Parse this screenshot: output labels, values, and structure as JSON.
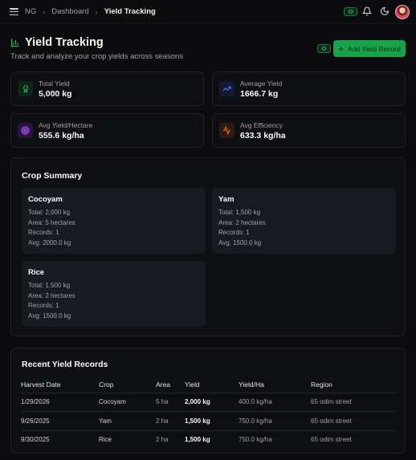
{
  "breadcrumb": {
    "items": [
      "NG",
      "Dashboard"
    ],
    "current": "Yield Tracking"
  },
  "header": {
    "title": "Yield Tracking",
    "subtitle": "Track and analyze your crop yields across seasons",
    "add_button": "Add Yield Record"
  },
  "stats": [
    {
      "label": "Total Yield",
      "value": "5,000 kg",
      "icon": "award-icon",
      "color": "#22c55e"
    },
    {
      "label": "Average Yield",
      "value": "1666.7 kg",
      "icon": "trending-up-icon",
      "color": "#3b82f6"
    },
    {
      "label": "Avg Yield/Hectare",
      "value": "555.6 kg/ha",
      "icon": "target-icon",
      "color": "#a855f7"
    },
    {
      "label": "Avg Efficiency",
      "value": "633.3 kg/ha",
      "icon": "activity-icon",
      "color": "#f97316"
    }
  ],
  "crop_summary": {
    "title": "Crop Summary",
    "crops": [
      {
        "name": "Cocoyam",
        "total": "Total: 2,000 kg",
        "area": "Area: 5 hectares",
        "records": "Records: 1",
        "avg": "Avg: 2000.0 kg"
      },
      {
        "name": "Yam",
        "total": "Total: 1,500 kg",
        "area": "Area: 2 hectares",
        "records": "Records: 1",
        "avg": "Avg: 1500.0 kg"
      },
      {
        "name": "Rice",
        "total": "Total: 1,500 kg",
        "area": "Area: 2 hectares",
        "records": "Records: 1",
        "avg": "Avg: 1500.0 kg"
      }
    ]
  },
  "records": {
    "title": "Recent Yield Records",
    "columns": [
      "Harvest Date",
      "Crop",
      "Area",
      "Yield",
      "Yield/Ha",
      "Region"
    ],
    "rows": [
      [
        "1/29/2026",
        "Cocoyam",
        "5 ha",
        "2,000 kg",
        "400.0 kg/ha",
        "65 odim street"
      ],
      [
        "9/26/2025",
        "Yam",
        "2 ha",
        "1,500 kg",
        "750.0 kg/ha",
        "65 odim street"
      ],
      [
        "9/30/2025",
        "Rice",
        "2 ha",
        "1,500 kg",
        "750.0 kg/ha",
        "65 odim street"
      ]
    ]
  },
  "colors": {
    "accent": "#16a34a",
    "background": "#0c0c0e",
    "card": "#171a21"
  }
}
